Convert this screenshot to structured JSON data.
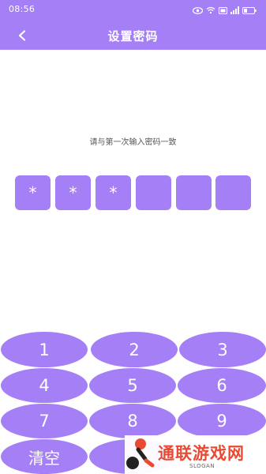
{
  "status_bar": {
    "time": "08:56",
    "icons": [
      "eye-icon",
      "wifi-icon",
      "hd-icon",
      "signal-icon",
      "battery-icon"
    ]
  },
  "app_bar": {
    "title": "设置密码",
    "back_icon": "chevron-left-icon"
  },
  "prompt": "请与第一次输入密码一致",
  "pin": {
    "boxes": [
      "*",
      "*",
      "*",
      "",
      "",
      ""
    ]
  },
  "keypad": {
    "key_1": "1",
    "key_2": "2",
    "key_3": "3",
    "key_4": "4",
    "key_5": "5",
    "key_6": "6",
    "key_7": "7",
    "key_8": "8",
    "key_9": "9",
    "clear": "清空"
  },
  "watermark": {
    "text": "通联游戏网",
    "slogan": "SLOGAN"
  },
  "colors": {
    "accent": "#a57ff5",
    "watermark_red": "#e84a33"
  }
}
